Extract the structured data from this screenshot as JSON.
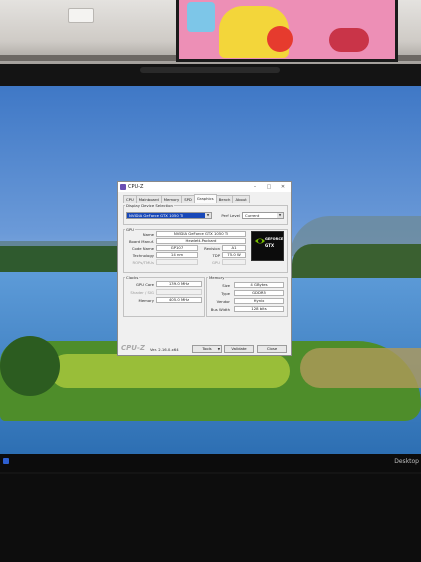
{
  "app": {
    "title": "CPU-Z",
    "tabs": [
      "CPU",
      "Mainboard",
      "Memory",
      "SPD",
      "Graphics",
      "Bench",
      "About"
    ],
    "active_tab": "Graphics"
  },
  "display_device": {
    "section_label": "Display Device Selection",
    "device": "NVIDIA GeForce GTX 1050 Ti",
    "perf_level_label": "Perf Level",
    "perf_level": "Current"
  },
  "gpu": {
    "section_label": "GPU",
    "fields": {
      "name_label": "Name",
      "name": "NVIDIA GeForce GTX 1050 Ti",
      "board_label": "Board Manuf.",
      "board": "Hewlett-Packard",
      "code_label": "Code Name",
      "code": "GP107",
      "revision_label": "Revision",
      "revision": "A1",
      "tech_label": "Technology",
      "tech": "14 nm",
      "tdp_label": "TDP",
      "tdp": "75.0 W",
      "rops_label": "ROPs/TMUs",
      "rops": "",
      "shaders_label": "GPU",
      "shaders": ""
    },
    "logo": {
      "line1": "GEFORCE",
      "line2": "GTX",
      "accent": "#76b900"
    }
  },
  "clocks": {
    "section_label": "Clocks",
    "gpu_core_label": "GPU Core",
    "gpu_core": "139.0 MHz",
    "shader_label": "Shader / SIG",
    "shader": "",
    "memory_label": "Memory",
    "memory": "405.0 MHz"
  },
  "memory": {
    "section_label": "Memory",
    "size_label": "Size",
    "size": "4 GBytes",
    "type_label": "Type",
    "type": "GDDR5",
    "vendor_label": "Vendor",
    "vendor": "Hynix",
    "bus_label": "Bus Width",
    "bus": "128 bits"
  },
  "footer": {
    "brand": "CPU-Z",
    "version": "Ver. 2.16.0.x64",
    "tools": "Tools",
    "validate": "Validate",
    "close": "Close"
  },
  "taskbar": {
    "desktop_label": "Desktop"
  }
}
